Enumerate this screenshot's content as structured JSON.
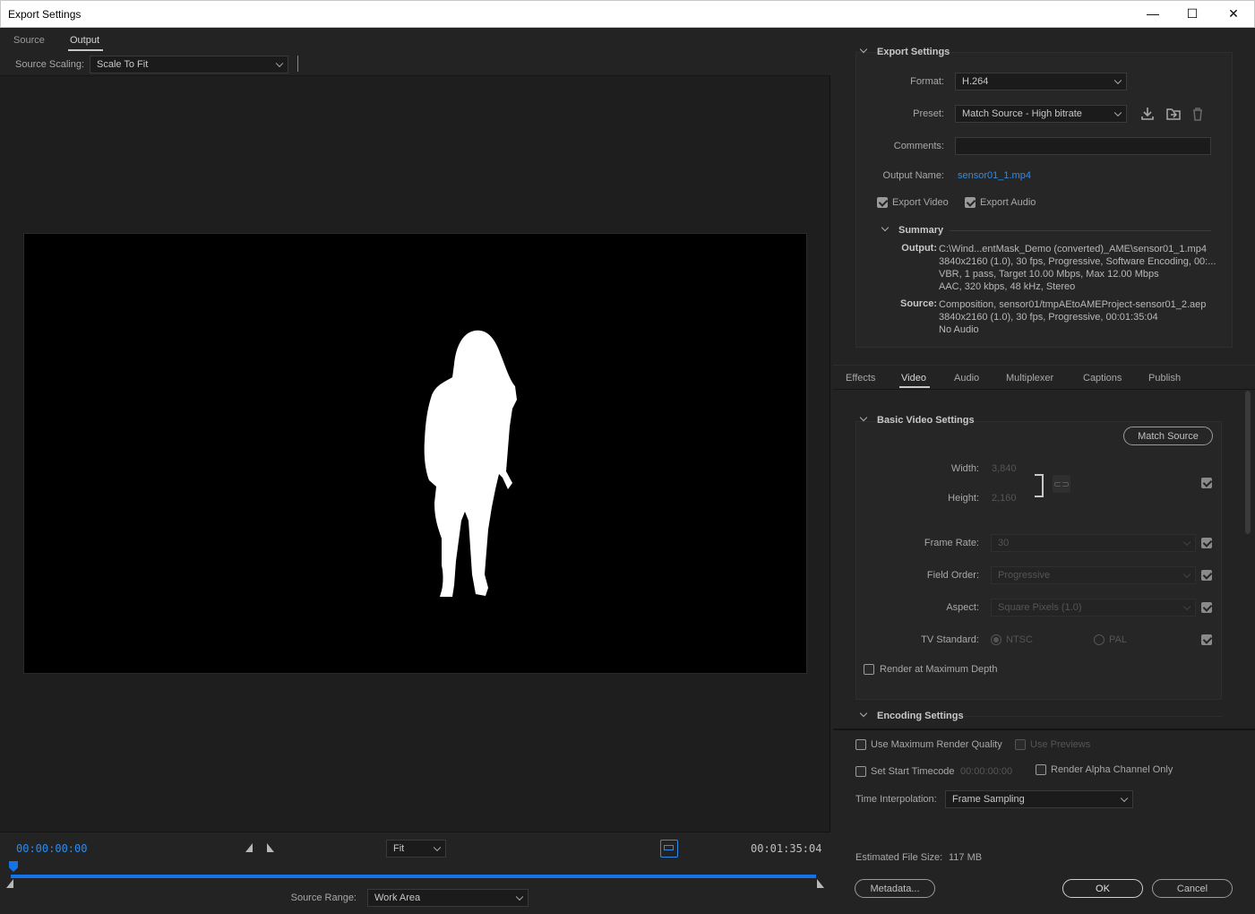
{
  "window": {
    "title": "Export Settings",
    "minimize": "—",
    "maximize": "☐",
    "close": "✕"
  },
  "left": {
    "tabs": [
      {
        "label": "Source"
      },
      {
        "label": "Output"
      }
    ],
    "source_scaling": {
      "label": "Source Scaling:",
      "value": "Scale To Fit"
    },
    "timeline": {
      "current": "00:00:00:00",
      "duration": "00:01:35:04",
      "zoom": "Fit",
      "source_range_label": "Source Range:",
      "source_range_value": "Work Area"
    }
  },
  "export": {
    "header": "Export Settings",
    "format_label": "Format:",
    "format": "H.264",
    "preset_label": "Preset:",
    "preset": "Match Source - High bitrate",
    "comments_label": "Comments:",
    "comments": "",
    "output_name_label": "Output Name:",
    "output_name": "sensor01_1.mp4",
    "export_video": "Export Video",
    "export_audio": "Export Audio",
    "summary": {
      "header": "Summary",
      "output_label": "Output:",
      "output_lines": [
        "C:\\Wind...entMask_Demo (converted)_AME\\sensor01_1.mp4",
        "3840x2160 (1.0), 30 fps, Progressive, Software Encoding, 00:...",
        "VBR, 1 pass, Target 10.00 Mbps, Max 12.00 Mbps",
        "AAC, 320 kbps, 48 kHz, Stereo"
      ],
      "source_label": "Source:",
      "source_lines": [
        "Composition, sensor01/tmpAEtoAMEProject-sensor01_2.aep",
        "3840x2160 (1.0), 30 fps, Progressive, 00:01:35:04",
        "No Audio"
      ]
    }
  },
  "tabs": [
    {
      "label": "Effects"
    },
    {
      "label": "Video"
    },
    {
      "label": "Audio"
    },
    {
      "label": "Multiplexer"
    },
    {
      "label": "Captions"
    },
    {
      "label": "Publish"
    }
  ],
  "video": {
    "header": "Basic Video Settings",
    "match_source": "Match Source",
    "width_label": "Width:",
    "width": "3,840",
    "height_label": "Height:",
    "height": "2,160",
    "frame_rate_label": "Frame Rate:",
    "frame_rate": "30",
    "field_order_label": "Field Order:",
    "field_order": "Progressive",
    "aspect_label": "Aspect:",
    "aspect": "Square Pixels (1.0)",
    "tv_standard_label": "TV Standard:",
    "ntsc": "NTSC",
    "pal": "PAL",
    "render_max_depth": "Render at Maximum Depth",
    "encoding_header": "Encoding Settings"
  },
  "bottom": {
    "max_render_quality": "Use Maximum Render Quality",
    "use_previews": "Use Previews",
    "set_start_timecode": "Set Start Timecode",
    "start_timecode": "00:00:00:00",
    "render_alpha": "Render Alpha Channel Only",
    "time_interp_label": "Time Interpolation:",
    "time_interp": "Frame Sampling",
    "file_size_label": "Estimated File Size:",
    "file_size": "117 MB",
    "metadata": "Metadata...",
    "ok": "OK",
    "cancel": "Cancel"
  }
}
